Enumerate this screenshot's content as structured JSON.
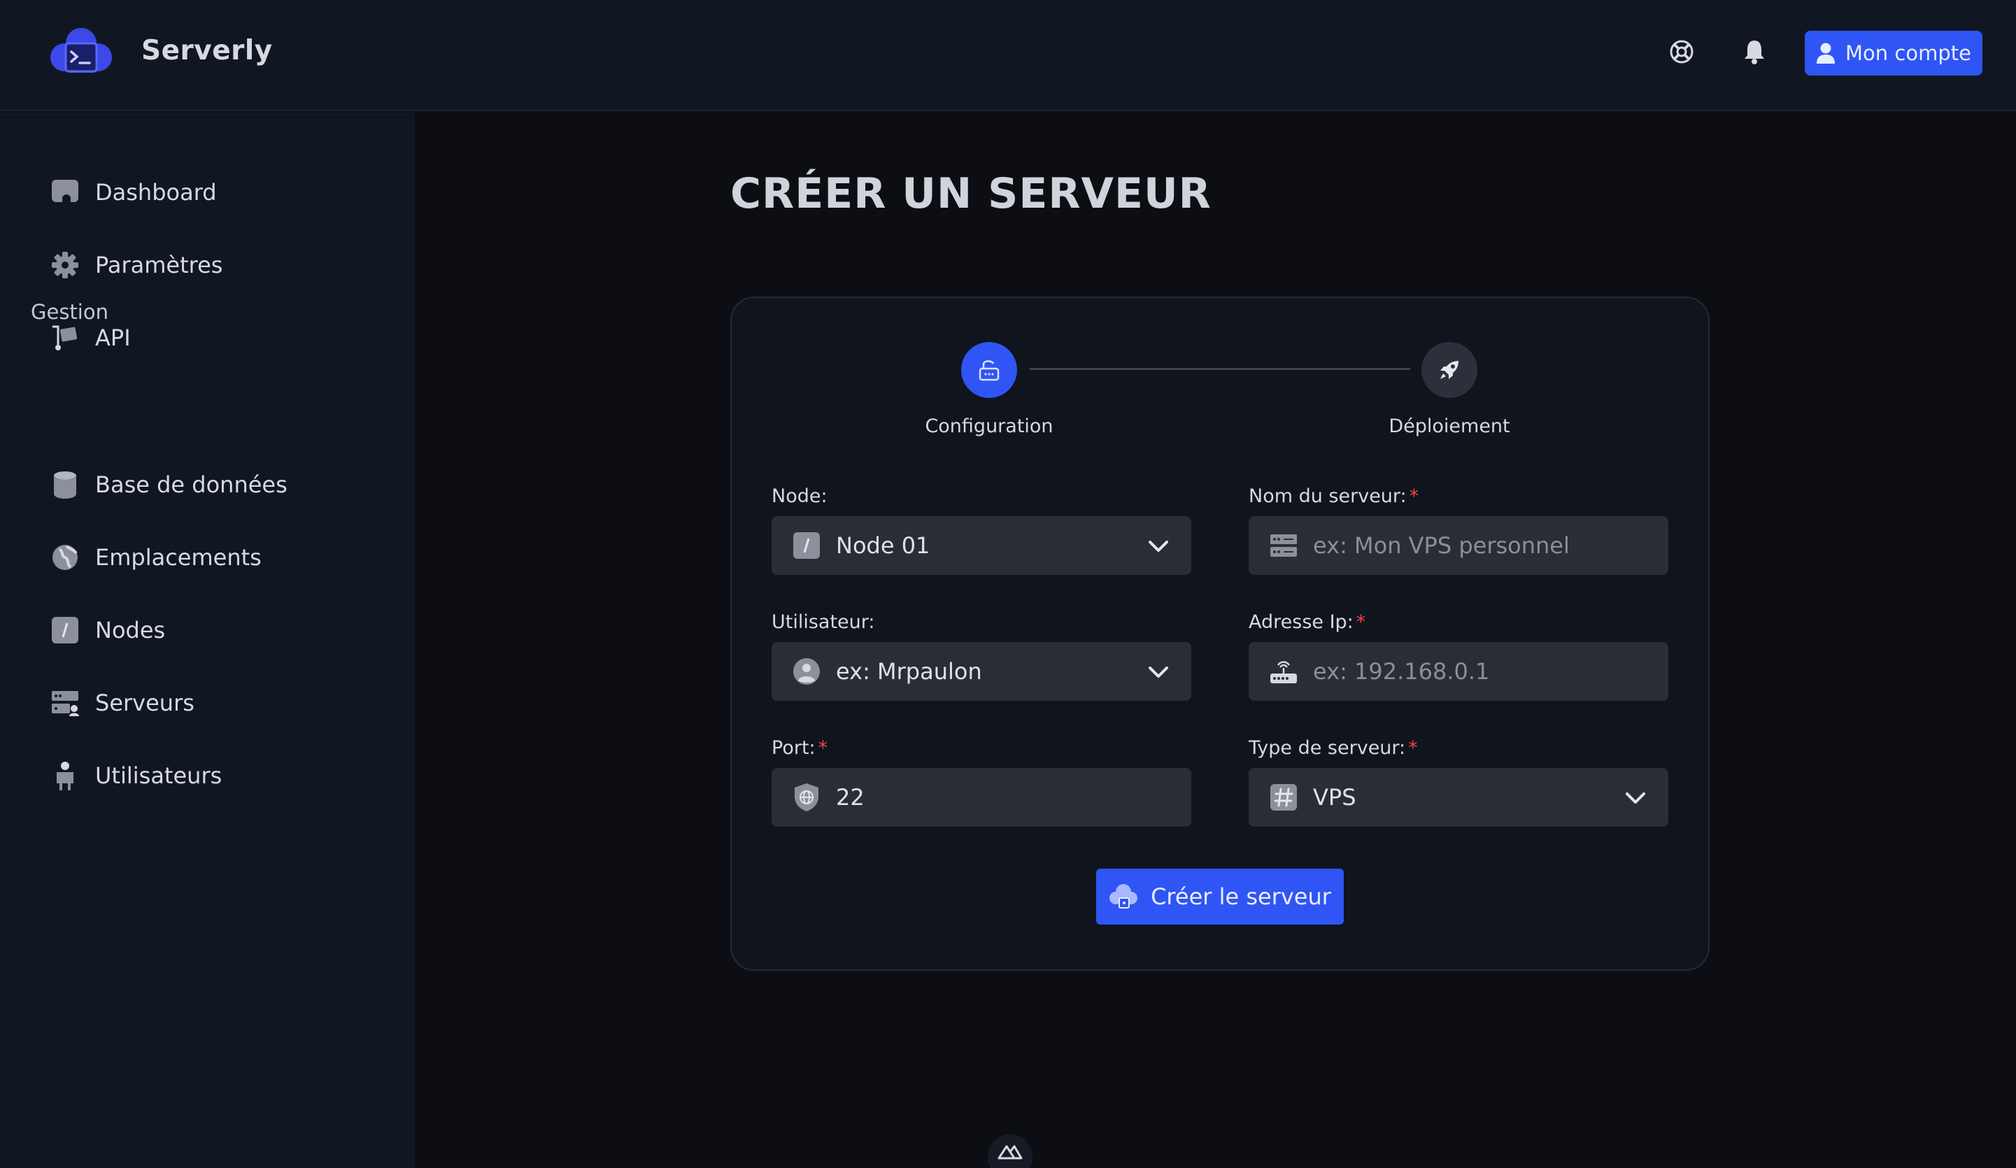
{
  "app": {
    "brand": "Serverly"
  },
  "header": {
    "account_label": "Mon compte"
  },
  "sidebar": {
    "items": [
      {
        "label": "Dashboard",
        "icon": "dashboard-icon"
      },
      {
        "label": "Paramètres",
        "icon": "gear-icon"
      },
      {
        "label": "API",
        "icon": "api-icon"
      }
    ],
    "section_label": "Gestion",
    "management_items": [
      {
        "label": "Base de données",
        "icon": "database-icon"
      },
      {
        "label": "Emplacements",
        "icon": "globe-icon"
      },
      {
        "label": "Nodes",
        "icon": "node-icon"
      },
      {
        "label": "Serveurs",
        "icon": "servers-icon"
      },
      {
        "label": "Utilisateurs",
        "icon": "users-icon"
      }
    ]
  },
  "main": {
    "title": "CRÉER UN SERVEUR",
    "steps": [
      {
        "label": "Configuration",
        "active": true
      },
      {
        "label": "Déploiement",
        "active": false
      }
    ],
    "form": {
      "node": {
        "label": "Node:",
        "value": "Node 01"
      },
      "server_name": {
        "label": "Nom du serveur:",
        "required_mark": "*",
        "placeholder": "ex: Mon VPS personnel"
      },
      "user": {
        "label": "Utilisateur:",
        "placeholder": "ex: Mrpaulon"
      },
      "ip": {
        "label": "Adresse Ip:",
        "required_mark": "*",
        "placeholder": "ex: 192.168.0.1"
      },
      "port": {
        "label": "Port:",
        "required_mark": "*",
        "value": "22"
      },
      "server_type": {
        "label": "Type de serveur:",
        "required_mark": "*",
        "value": "VPS"
      }
    },
    "submit_label": "Créer le serveur"
  },
  "colors": {
    "accent": "#2f55f5",
    "required": "#ef4444",
    "background": "#0c0e13",
    "panel": "#111722"
  }
}
